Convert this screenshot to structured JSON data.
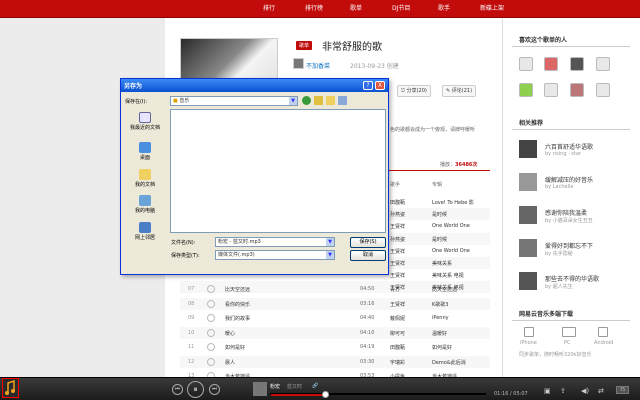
{
  "nav": {
    "items": [
      "排行",
      "排行榜",
      "歌单",
      "DJ节目",
      "歌手",
      "新碟上架"
    ]
  },
  "playlist": {
    "tag": "歌单",
    "title": "非常舒服的歌",
    "creator": "不加香菜",
    "date": "2013-09-23 创建",
    "share_label": "分享(20)",
    "comment_label": "评论(21)",
    "desc_start": "色的歌都会成为一个旁观，请牌呼暖听",
    "desc_link": "",
    "play_count_label": "播放：",
    "play_count": "36486次"
  },
  "table": {
    "headers": {
      "artist": "歌手",
      "album": "专辑"
    },
    "partial_rows": [
      {
        "art": "田馥甄",
        "alb": "Love! To Hebe 影"
      },
      {
        "art": "孙燕姿",
        "alb": "是时候"
      },
      {
        "art": "王贤祥",
        "alb": "One World One"
      },
      {
        "art": "孙燕姿",
        "alb": "是时候"
      },
      {
        "art": "王贤祥",
        "alb": "One World One"
      },
      {
        "art": "王贤祥",
        "alb": "美味关系"
      },
      {
        "art": "王贤祥",
        "alb": "美味关系 电视"
      },
      {
        "art": "王贤祥",
        "alb": "美味关系 电视"
      }
    ],
    "rows": [
      {
        "idx": "07",
        "name": "比天空还远",
        "dur": "04:50",
        "art": "青方",
        "alb": "比天空还远"
      },
      {
        "idx": "08",
        "name": "看你的快乐",
        "dur": "03:16",
        "art": "王贤祥",
        "alb": "K歌歌3"
      },
      {
        "idx": "09",
        "name": "我们的故事",
        "dur": "04:40",
        "art": "戴佩妮",
        "alb": "iPenny"
      },
      {
        "idx": "10",
        "name": "暖心",
        "dur": "04:10",
        "art": "柳可可",
        "alb": "温暖好"
      },
      {
        "idx": "11",
        "name": "如何是好",
        "dur": "04:19",
        "art": "田馥甄",
        "alb": "如何是好"
      },
      {
        "idx": "12",
        "name": "晨人",
        "dur": "03:30",
        "art": "宇瑞彩",
        "alb": "Demo&此后消"
      },
      {
        "idx": "13",
        "name": "当木若地遥",
        "dur": "03:53",
        "art": "小提鱼",
        "alb": "当木若地遥"
      }
    ]
  },
  "sidebar": {
    "fans_title": "喜欢这个歌单的人",
    "rec_title": "相关推荐",
    "recs": [
      {
        "title": "六百首舒适华语歌",
        "by": "by rising · star"
      },
      {
        "title": "缓解减压的好音乐",
        "by": "by Lachelle"
      },
      {
        "title": "感谢你陪我温柔",
        "by": "by 小猫耳朵女生丑丑"
      },
      {
        "title": "爱得好到都忘不下",
        "by": "by 先手隐秘"
      },
      {
        "title": "那些去不得的华语歌",
        "by": "by 超人先生"
      }
    ],
    "devices_title": "网易云音乐多端下载",
    "devices": [
      "iPhone",
      "PC",
      "Android"
    ],
    "footer_text": "同步歌单，随时畅听320k好音乐"
  },
  "dialog": {
    "title": "另存为",
    "save_in_label": "保存在(I):",
    "save_in_value": "音乐",
    "places": [
      "我最近的文档",
      "桌面",
      "我的文档",
      "我的电脑",
      "网上邻居"
    ],
    "filename_label": "文件名(N):",
    "filename_value": "粉宏 - 蓝又时.mp3",
    "filetype_label": "保存类型(T):",
    "filetype_value": "媒体文件(.mp3)",
    "save_button": "保存(S)",
    "cancel_button": "取消",
    "help_glyph": "?",
    "close_glyph": "X"
  },
  "player": {
    "song": "粉宏",
    "artist": "蓝又时",
    "time": "01:16 / 05:07",
    "progress": 0.25,
    "volume_badge": "75",
    "prev_glyph": "⏮",
    "pause_glyph": "⏸",
    "next_glyph": "⏭",
    "link_glyph": "🔗"
  },
  "colors": {
    "accent": "#c20c0c",
    "player_bg": "#2a2a2a",
    "dialog_title": "#0a50d0"
  }
}
